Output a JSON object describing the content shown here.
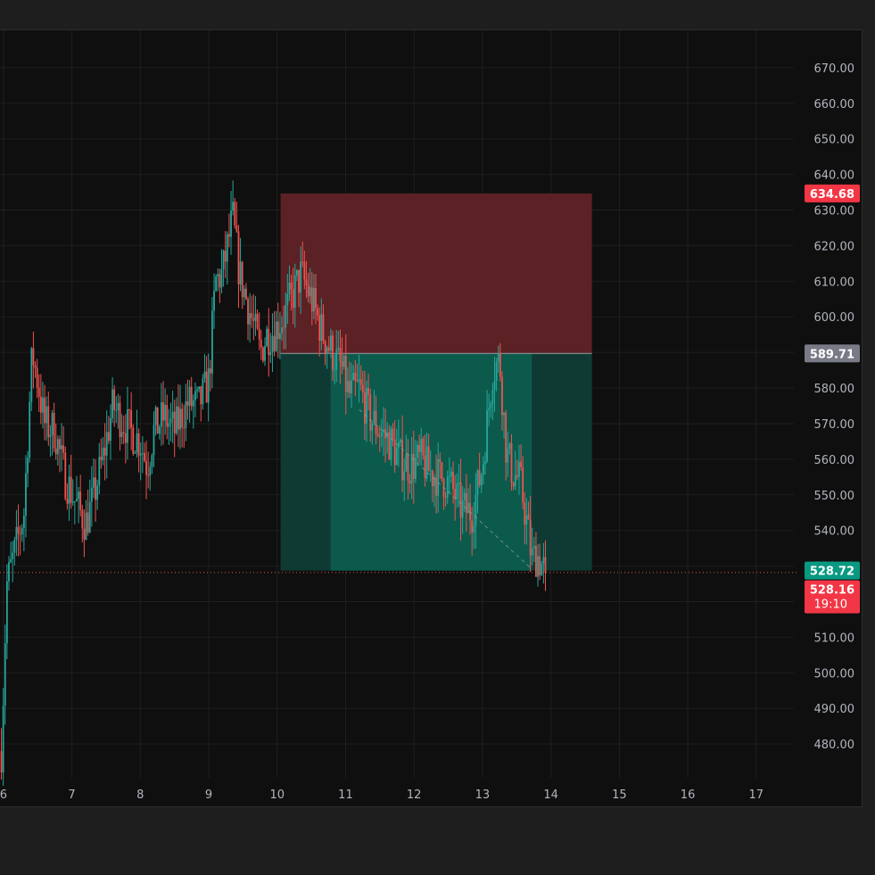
{
  "colors": {
    "up": "#26a69a",
    "down": "#ef5350",
    "stop_zone": "#5b2124",
    "target_zone": "#0c5a4c",
    "target_zone_dim": "#0f3a33",
    "entry_badge": "#787b86",
    "stop_badge": "#f23645",
    "target_badge": "#089981",
    "last_price_badge": "#f23645",
    "grid": "#1f1f1f",
    "last_price_line": "#e0584e"
  },
  "chart_data": {
    "type": "candlestick",
    "x_ticks": [
      "6",
      "7",
      "8",
      "9",
      "10",
      "11",
      "12",
      "13",
      "14",
      "15",
      "16",
      "17"
    ],
    "x_range": [
      5.95,
      17.55
    ],
    "y_ticks": [
      "670.00",
      "660.00",
      "650.00",
      "640.00",
      "630.00",
      "620.00",
      "610.00",
      "600.00",
      "590.00",
      "580.00",
      "570.00",
      "560.00",
      "550.00",
      "540.00",
      "530.00",
      "520.00",
      "510.00",
      "500.00",
      "490.00",
      "480.00"
    ],
    "y_range": [
      470.5,
      680.5
    ],
    "grid": true,
    "price_path": [
      [
        5.97,
        478
      ],
      [
        6.05,
        525
      ],
      [
        6.18,
        535
      ],
      [
        6.3,
        545
      ],
      [
        6.42,
        590
      ],
      [
        6.5,
        582
      ],
      [
        6.6,
        570
      ],
      [
        6.75,
        568
      ],
      [
        6.9,
        555
      ],
      [
        7.05,
        548
      ],
      [
        7.2,
        542
      ],
      [
        7.3,
        548
      ],
      [
        7.45,
        560
      ],
      [
        7.6,
        575
      ],
      [
        7.7,
        572
      ],
      [
        7.85,
        568
      ],
      [
        8.0,
        565
      ],
      [
        8.1,
        558
      ],
      [
        8.2,
        568
      ],
      [
        8.35,
        572
      ],
      [
        8.5,
        568
      ],
      [
        8.6,
        572
      ],
      [
        8.7,
        576
      ],
      [
        8.85,
        575
      ],
      [
        9.0,
        582
      ],
      [
        9.1,
        610
      ],
      [
        9.2,
        612
      ],
      [
        9.35,
        628
      ],
      [
        9.45,
        612
      ],
      [
        9.55,
        605
      ],
      [
        9.65,
        598
      ],
      [
        9.75,
        590
      ],
      [
        9.85,
        595
      ],
      [
        9.95,
        596
      ],
      [
        10.1,
        600
      ],
      [
        10.2,
        605
      ],
      [
        10.35,
        612
      ],
      [
        10.5,
        605
      ],
      [
        10.65,
        596
      ],
      [
        10.8,
        590
      ],
      [
        10.95,
        585
      ],
      [
        11.05,
        578
      ],
      [
        11.2,
        580
      ],
      [
        11.35,
        572
      ],
      [
        11.5,
        568
      ],
      [
        11.65,
        565
      ],
      [
        11.8,
        560
      ],
      [
        11.95,
        558
      ],
      [
        12.1,
        560
      ],
      [
        12.25,
        556
      ],
      [
        12.4,
        555
      ],
      [
        12.55,
        552
      ],
      [
        12.7,
        546
      ],
      [
        12.85,
        545
      ],
      [
        13.0,
        558
      ],
      [
        13.15,
        585
      ],
      [
        13.25,
        588
      ],
      [
        13.35,
        562
      ],
      [
        13.45,
        556
      ],
      [
        13.55,
        554
      ],
      [
        13.65,
        542
      ],
      [
        13.72,
        532
      ],
      [
        13.8,
        533
      ],
      [
        13.92,
        528.16
      ]
    ],
    "trend_line": [
      [
        11.2,
        574
      ],
      [
        13.7,
        529.5
      ]
    ],
    "position": {
      "x_start": 10.05,
      "x_end": 14.6,
      "entry": 589.71,
      "stop": 634.68,
      "target": 528.72,
      "active_x_start": 10.78,
      "active_x_end": 13.72
    },
    "last_price": 528.16
  },
  "badges": {
    "stop": "634.68",
    "entry": "589.71",
    "target": "528.72",
    "last_price": "528.16",
    "countdown": "19:10"
  }
}
